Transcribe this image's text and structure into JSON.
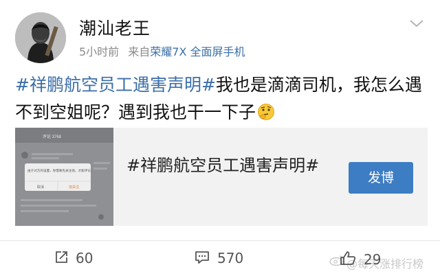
{
  "post": {
    "username": "潮汕老王",
    "time": "5小时前",
    "source_prefix": "来自",
    "device": "荣耀7X 全面屏手机",
    "content": {
      "hashtag": "#祥鹏航空员工遇害声明#",
      "text": "我也是滴滴司机，我怎么遇不到空姐呢？遇到我也干一下子"
    },
    "emoji_icon": "thinking-face-icon"
  },
  "card": {
    "title": "#祥鹏航空员工遇害声明#",
    "button_label": "发博",
    "thumbnail": {
      "dialog_text": "由于对方的设置，你需要先关注他，才能评论。",
      "left_button": "取消",
      "right_button": "加关注",
      "header_text": "评论 3768"
    }
  },
  "actions": {
    "repost_count": "60",
    "comment_count": "570",
    "like_count": "29"
  },
  "watermark": {
    "text": "@每天涨排行榜"
  },
  "colors": {
    "link_blue": "#3b6ea8",
    "button_blue": "#3d7dc4",
    "meta_gray": "#8a8a8a",
    "card_bg": "#f2f2f2"
  }
}
